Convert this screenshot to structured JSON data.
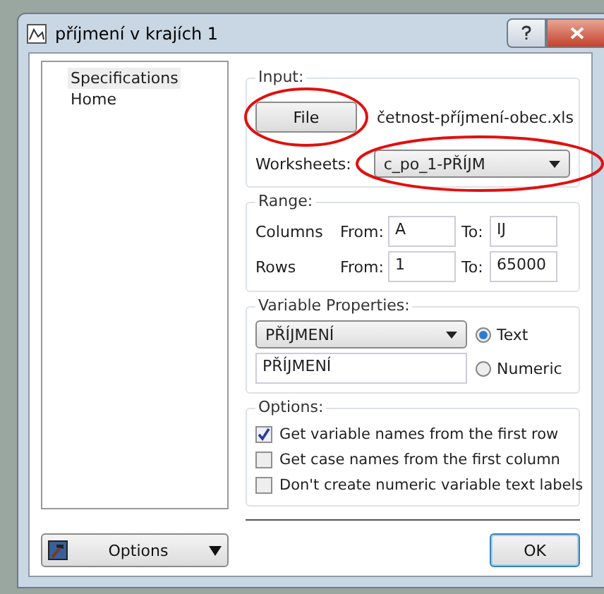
{
  "window": {
    "title": "příjmení v krajích 1"
  },
  "sidebar": {
    "items": [
      {
        "label": "Specifications",
        "selected": true
      },
      {
        "label": "Home",
        "selected": false
      }
    ]
  },
  "input": {
    "legend": "Input:",
    "file_button": "File",
    "file_name": "četnost-příjmení-obec.xls",
    "worksheets_label": "Worksheets:",
    "worksheet": "c_po_1-PŘÍJM"
  },
  "range": {
    "legend": "Range:",
    "rows": [
      {
        "label": "Columns",
        "from_label": "From:",
        "from": "A",
        "to_label": "To:",
        "to": "IJ"
      },
      {
        "label": "Rows",
        "from_label": "From:",
        "from": "1",
        "to_label": "To:",
        "to": "65000"
      }
    ]
  },
  "variable_properties": {
    "legend": "Variable Properties:",
    "variable": "PŘÍJMENÍ",
    "name": "PŘÍJMENÍ",
    "types": [
      {
        "label": "Text",
        "selected": true
      },
      {
        "label": "Numeric",
        "selected": false
      }
    ]
  },
  "options": {
    "legend": "Options:",
    "checkboxes": [
      {
        "label": "Get variable names from the first row",
        "checked": true
      },
      {
        "label": "Get case names from the first column",
        "checked": false
      },
      {
        "label": "Don't create numeric variable text labels",
        "checked": false
      }
    ]
  },
  "footer": {
    "options_button": "Options",
    "ok_button": "OK"
  }
}
